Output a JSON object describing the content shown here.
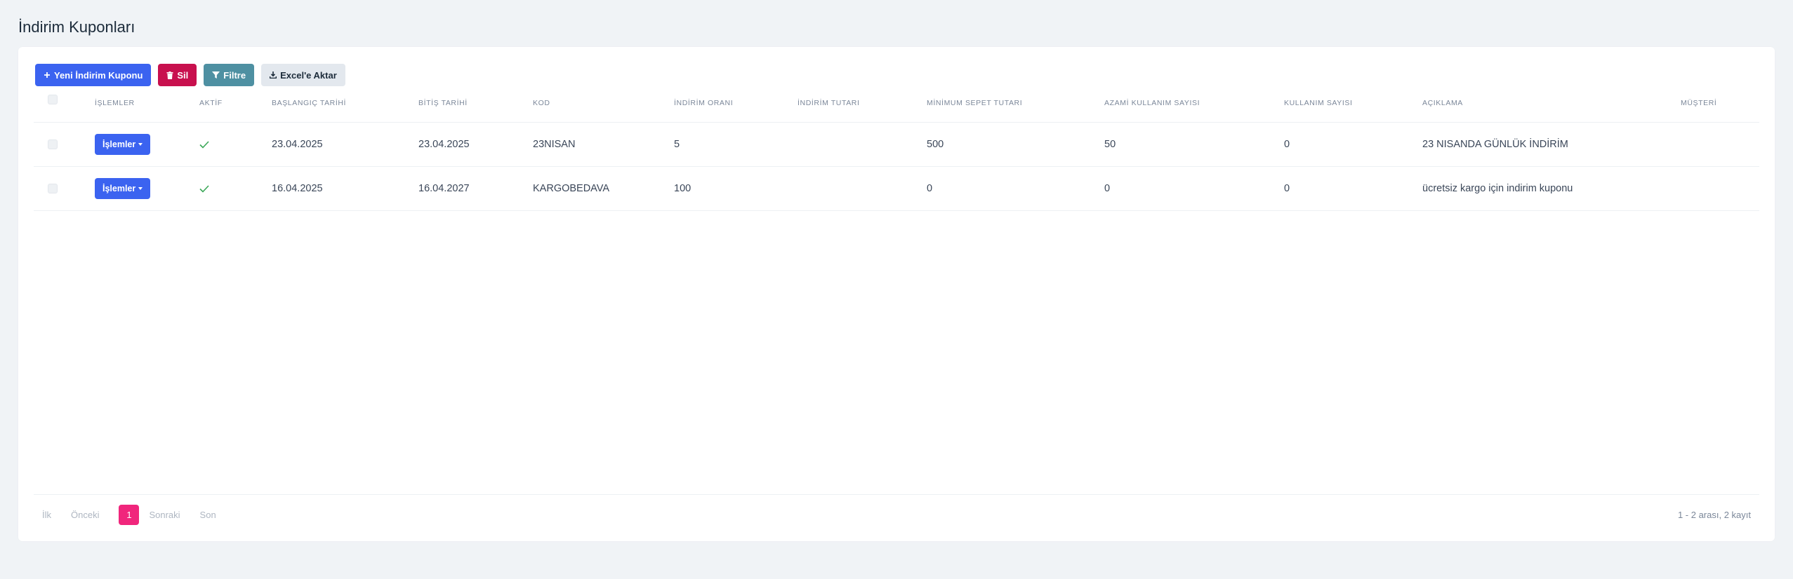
{
  "page": {
    "title": "İndirim Kuponları"
  },
  "toolbar": {
    "new_label": "Yeni İndirim Kuponu",
    "delete_label": "Sil",
    "filter_label": "Filtre",
    "export_label": "Excel'e Aktar"
  },
  "table": {
    "columns": [
      "İŞLEMLER",
      "AKTİF",
      "BAŞLANGIÇ TARİHİ",
      "BİTİŞ TARİHİ",
      "KOD",
      "İNDİRİM ORANI",
      "İNDİRİM TUTARI",
      "MİNİMUM SEPET TUTARI",
      "AZAMİ KULLANIM SAYISI",
      "KULLANIM SAYISI",
      "AÇIKLAMA",
      "MÜŞTERİ"
    ],
    "rows": [
      {
        "ops": "İşlemler",
        "active": true,
        "start": "23.04.2025",
        "end": "23.04.2025",
        "code": "23NISAN",
        "rate": "5",
        "amount": "",
        "min_basket": "500",
        "max_usage": "50",
        "usage": "0",
        "description": "23 NISANDA GÜNLÜK İNDİRİM",
        "customer": ""
      },
      {
        "ops": "İşlemler",
        "active": true,
        "start": "16.04.2025",
        "end": "16.04.2027",
        "code": "KARGOBEDAVA",
        "rate": "100",
        "amount": "",
        "min_basket": "0",
        "max_usage": "0",
        "usage": "0",
        "description": "ücretsiz kargo için indirim kuponu",
        "customer": ""
      }
    ]
  },
  "pagination": {
    "first": "İlk",
    "prev": "Önceki",
    "current": "1",
    "next": "Sonraki",
    "last": "Son",
    "info": "1 - 2 arası, 2 kayıt"
  },
  "colors": {
    "primary": "#3b63f0",
    "danger": "#c8104e",
    "info": "#4e90a2",
    "active_page": "#f0267c",
    "check": "#3aa757"
  }
}
